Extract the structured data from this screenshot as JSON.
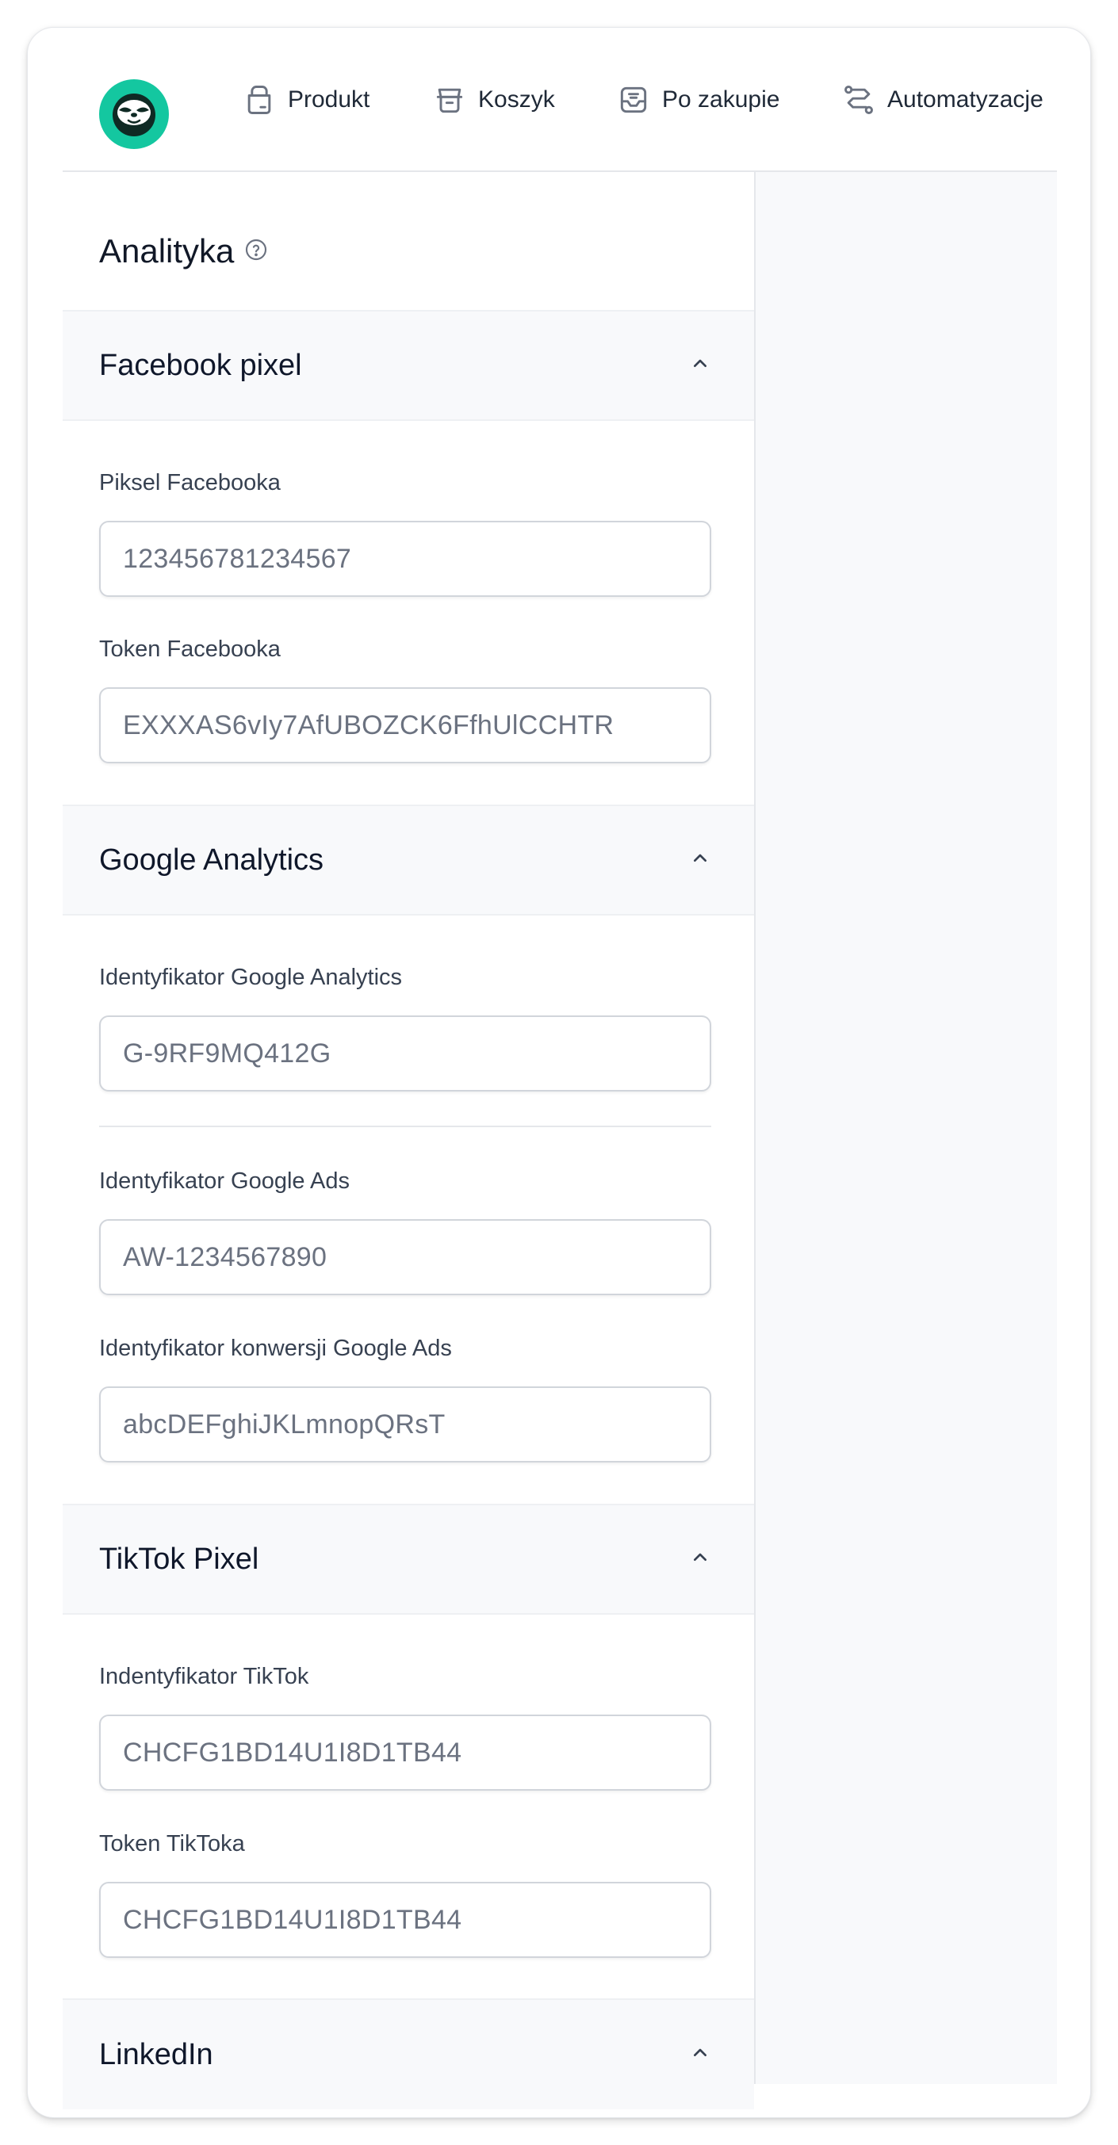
{
  "nav": {
    "items": [
      {
        "label": "Produkt",
        "icon": "product-icon"
      },
      {
        "label": "Koszyk",
        "icon": "cart-icon"
      },
      {
        "label": "Po zakupie",
        "icon": "inbox-icon"
      },
      {
        "label": "Automatyzacje",
        "icon": "route-icon"
      }
    ]
  },
  "page": {
    "title": "Analityka",
    "help_icon": "question-circle-icon"
  },
  "sections": {
    "facebook": {
      "title": "Facebook pixel",
      "fields": [
        {
          "label": "Piksel Facebooka",
          "value": "123456781234567"
        },
        {
          "label": "Token Facebooka",
          "value": "EXXXAS6vIy7AfUBOZCK6FfhUlCCHTR"
        }
      ]
    },
    "google": {
      "title": "Google Analytics",
      "fields": [
        {
          "label": "Identyfikator Google Analytics",
          "value": "G-9RF9MQ412G"
        },
        {
          "label": "Identyfikator Google Ads",
          "value": "AW-1234567890"
        },
        {
          "label": "Identyfikator konwersji Google Ads",
          "value": "abcDEFghiJKLmnopQRsT"
        }
      ]
    },
    "tiktok": {
      "title": "TikTok Pixel",
      "fields": [
        {
          "label": "Indentyfikator TikTok",
          "value": "CHCFG1BD14U1I8D1TB44"
        },
        {
          "label": "Token TikToka",
          "value": "CHCFG1BD14U1I8D1TB44"
        }
      ]
    },
    "linkedin": {
      "title": "LinkedIn"
    }
  },
  "colors": {
    "brand": "#14c7a0",
    "panel": "#f8f9fb",
    "border": "#e5e7eb"
  }
}
